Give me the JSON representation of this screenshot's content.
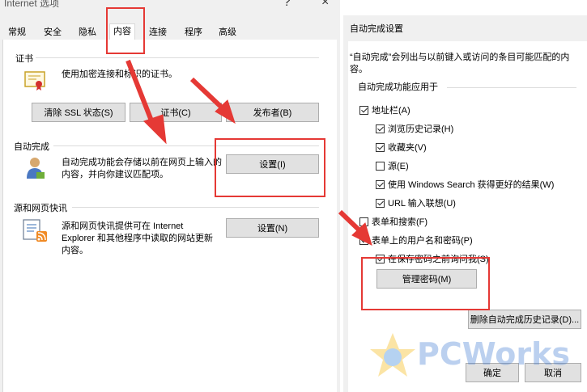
{
  "left": {
    "title": "Internet 选项",
    "help_btn": "?",
    "close_btn": "×",
    "tabs": [
      "常规",
      "安全",
      "隐私",
      "内容",
      "连接",
      "程序",
      "高级"
    ],
    "cert": {
      "group": "证书",
      "desc": "使用加密连接和标识的证书。",
      "clear_ssl": "清除 SSL 状态(S)",
      "certs": "证书(C)",
      "publishers": "发布者(B)"
    },
    "autocomplete": {
      "group": "自动完成",
      "desc_line1": "自动完成功能会存储以前在网页上输入的",
      "desc_line2": "内容，并向你建议匹配项。",
      "settings": "设置(I)"
    },
    "feeds": {
      "group": "源和网页快讯",
      "desc_line1": "源和网页快讯提供可在 Internet",
      "desc_line2": "Explorer 和其他程序中读取的网站更新",
      "desc_line3": "内容。",
      "settings": "设置(N)"
    }
  },
  "right": {
    "title": "自动完成设置",
    "intro": "“自动完成”会列出与以前键入或访问的条目可能匹配的内容。",
    "use_for": "自动完成功能应用于",
    "options": {
      "address_bar": "地址栏(A)",
      "browse_history": "浏览历史记录(H)",
      "favorites": "收藏夹(V)",
      "feeds": "源(E)",
      "windows_search": "使用 Windows Search 获得更好的结果(W)",
      "url_suggest": "URL 输入联想(U)",
      "forms": "表单和搜索(F)",
      "usernames": "表单上的用户名和密码(P)",
      "ask_before_save": "在保存密码之前询问我(S)"
    },
    "checked": {
      "address_bar": true,
      "browse_history": true,
      "favorites": true,
      "feeds": false,
      "windows_search": true,
      "url_suggest": true,
      "forms": false,
      "usernames": true,
      "ask_before_save": true
    },
    "manage_passwords": "管理密码(M)",
    "delete_history": "删除自动完成历史记录(D)...",
    "ok": "确定",
    "cancel": "取消"
  },
  "watermark": {
    "text": "PCWorks"
  },
  "colors": {
    "annotation_red": "#e53935",
    "dialog_bg": "#f0f0f0",
    "button_bg": "#e1e1e1"
  }
}
